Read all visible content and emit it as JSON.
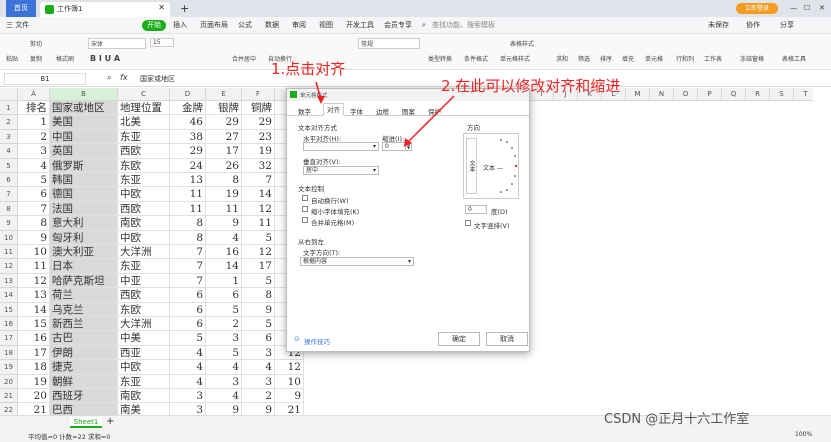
{
  "tabs": {
    "home": "首页",
    "doc": "工作簿1",
    "add": "+",
    "login": "立即登录",
    "win_min": "—",
    "win_max": "☐",
    "win_close": "✕"
  },
  "menu": {
    "file": "三 文件",
    "items": [
      "开始",
      "插入",
      "页面布局",
      "公式",
      "数据",
      "审阅",
      "视图",
      "开发工具",
      "会员专享"
    ],
    "search": "查找功能、搜索模板",
    "right": [
      "未保存",
      "协作",
      "分享"
    ]
  },
  "ribbon": {
    "paste": "粘贴",
    "cut": "剪切",
    "copy": "复制",
    "format_painter": "格式刷",
    "font": "宋体",
    "size": "15",
    "merge": "合并居中",
    "wrap": "自动换行",
    "numfmt": "常规",
    "types": "类型转换",
    "cond": "条件格式",
    "table": "表格样式",
    "cellstyle": "单元格样式",
    "sum": "求和",
    "filter": "筛选",
    "sort": "排序",
    "fill": "填充",
    "cells": "单元格",
    "rowcol": "行和列",
    "sheet": "工作表",
    "freeze": "冻结窗格",
    "tools": "表格工具"
  },
  "formula": {
    "namebox": "B1",
    "fx": "fx",
    "content": "国家或地区"
  },
  "columns": [
    "A",
    "B",
    "C",
    "D",
    "E",
    "F",
    "G"
  ],
  "rows": [
    [
      "排名",
      "国家或地区",
      "地理位置",
      "金牌",
      "银牌",
      "铜牌",
      "奖"
    ],
    [
      "1",
      "美国",
      "北美",
      "46",
      "29",
      "29",
      ""
    ],
    [
      "2",
      "中国",
      "东亚",
      "38",
      "27",
      "23",
      ""
    ],
    [
      "3",
      "英国",
      "西欧",
      "29",
      "17",
      "19",
      ""
    ],
    [
      "4",
      "俄罗斯",
      "东欧",
      "24",
      "26",
      "32",
      ""
    ],
    [
      "5",
      "韩国",
      "东亚",
      "13",
      "8",
      "7",
      ""
    ],
    [
      "6",
      "德国",
      "中欧",
      "11",
      "19",
      "14",
      ""
    ],
    [
      "7",
      "法国",
      "西欧",
      "11",
      "11",
      "12",
      ""
    ],
    [
      "8",
      "意大利",
      "南欧",
      "8",
      "9",
      "11",
      ""
    ],
    [
      "9",
      "匈牙利",
      "中欧",
      "8",
      "4",
      "5",
      ""
    ],
    [
      "10",
      "澳大利亚",
      "大洋洲",
      "7",
      "16",
      "12",
      ""
    ],
    [
      "11",
      "日本",
      "东亚",
      "7",
      "14",
      "17",
      ""
    ],
    [
      "12",
      "哈萨克斯坦",
      "中亚",
      "7",
      "1",
      "5",
      ""
    ],
    [
      "13",
      "荷兰",
      "西欧",
      "6",
      "6",
      "8",
      ""
    ],
    [
      "14",
      "乌克兰",
      "东欧",
      "6",
      "5",
      "9",
      ""
    ],
    [
      "15",
      "新西兰",
      "大洋洲",
      "6",
      "2",
      "5",
      ""
    ],
    [
      "16",
      "古巴",
      "中美",
      "5",
      "3",
      "6",
      ""
    ],
    [
      "17",
      "伊朗",
      "西亚",
      "4",
      "5",
      "3",
      "12"
    ],
    [
      "18",
      "捷克",
      "中欧",
      "4",
      "4",
      "4",
      "12"
    ],
    [
      "19",
      "朝鲜",
      "东亚",
      "4",
      "3",
      "3",
      "10"
    ],
    [
      "20",
      "西班牙",
      "南欧",
      "3",
      "4",
      "2",
      "9"
    ],
    [
      "21",
      "巴西",
      "南美",
      "3",
      "9",
      "9",
      "21"
    ],
    [
      "",
      ""
    ]
  ],
  "row_nums": [
    "1",
    "2",
    "3",
    "4",
    "5",
    "6",
    "7",
    "8",
    "9",
    "10",
    "11",
    "12",
    "13",
    "14",
    "15",
    "16",
    "17",
    "18",
    "19",
    "20",
    "21",
    "22",
    "23"
  ],
  "more_cols": [
    "I",
    "J",
    "K",
    "L",
    "M",
    "N",
    "O",
    "P",
    "Q",
    "R",
    "S",
    "T"
  ],
  "dialog": {
    "title": "单元格格式",
    "tabs": [
      "数字",
      "对齐",
      "字体",
      "边框",
      "图案",
      "保护"
    ],
    "text_align": "文本对齐方式",
    "h_align": "水平对齐(H):",
    "h_val": "",
    "indent": "缩进(I):",
    "indent_val": "0",
    "v_align": "垂直对齐(V):",
    "v_val": "居中",
    "text_ctrl": "文本控制",
    "wrap": "自动换行(W)",
    "shrink": "缩小字体填充(K)",
    "merge": "合并单元格(M)",
    "rtl": "从右到左",
    "direction": "文字方向(T):",
    "dir_val": "根据内容",
    "orient": "方向",
    "orient_text_v": "文本",
    "orient_text_h": "文本 —",
    "deg_val": "0",
    "deg": "度(D)",
    "stack": "文字竖排(V)",
    "tips": "操作技巧",
    "ok": "确定",
    "cancel": "取消"
  },
  "annotations": {
    "a1": "1.点击对齐",
    "a2": "2.在此可以修改对齐和缩进"
  },
  "sheet": {
    "tab": "Sheet1",
    "add": "+"
  },
  "status": {
    "left": "平均值=0  计数=22  求和=0",
    "right": "100%",
    "watermark": "CSDN @正月十六工作室"
  },
  "colors": {
    "accent": "#1aad19",
    "annotation": "#ee2222",
    "selected": "#d9d9d9"
  }
}
